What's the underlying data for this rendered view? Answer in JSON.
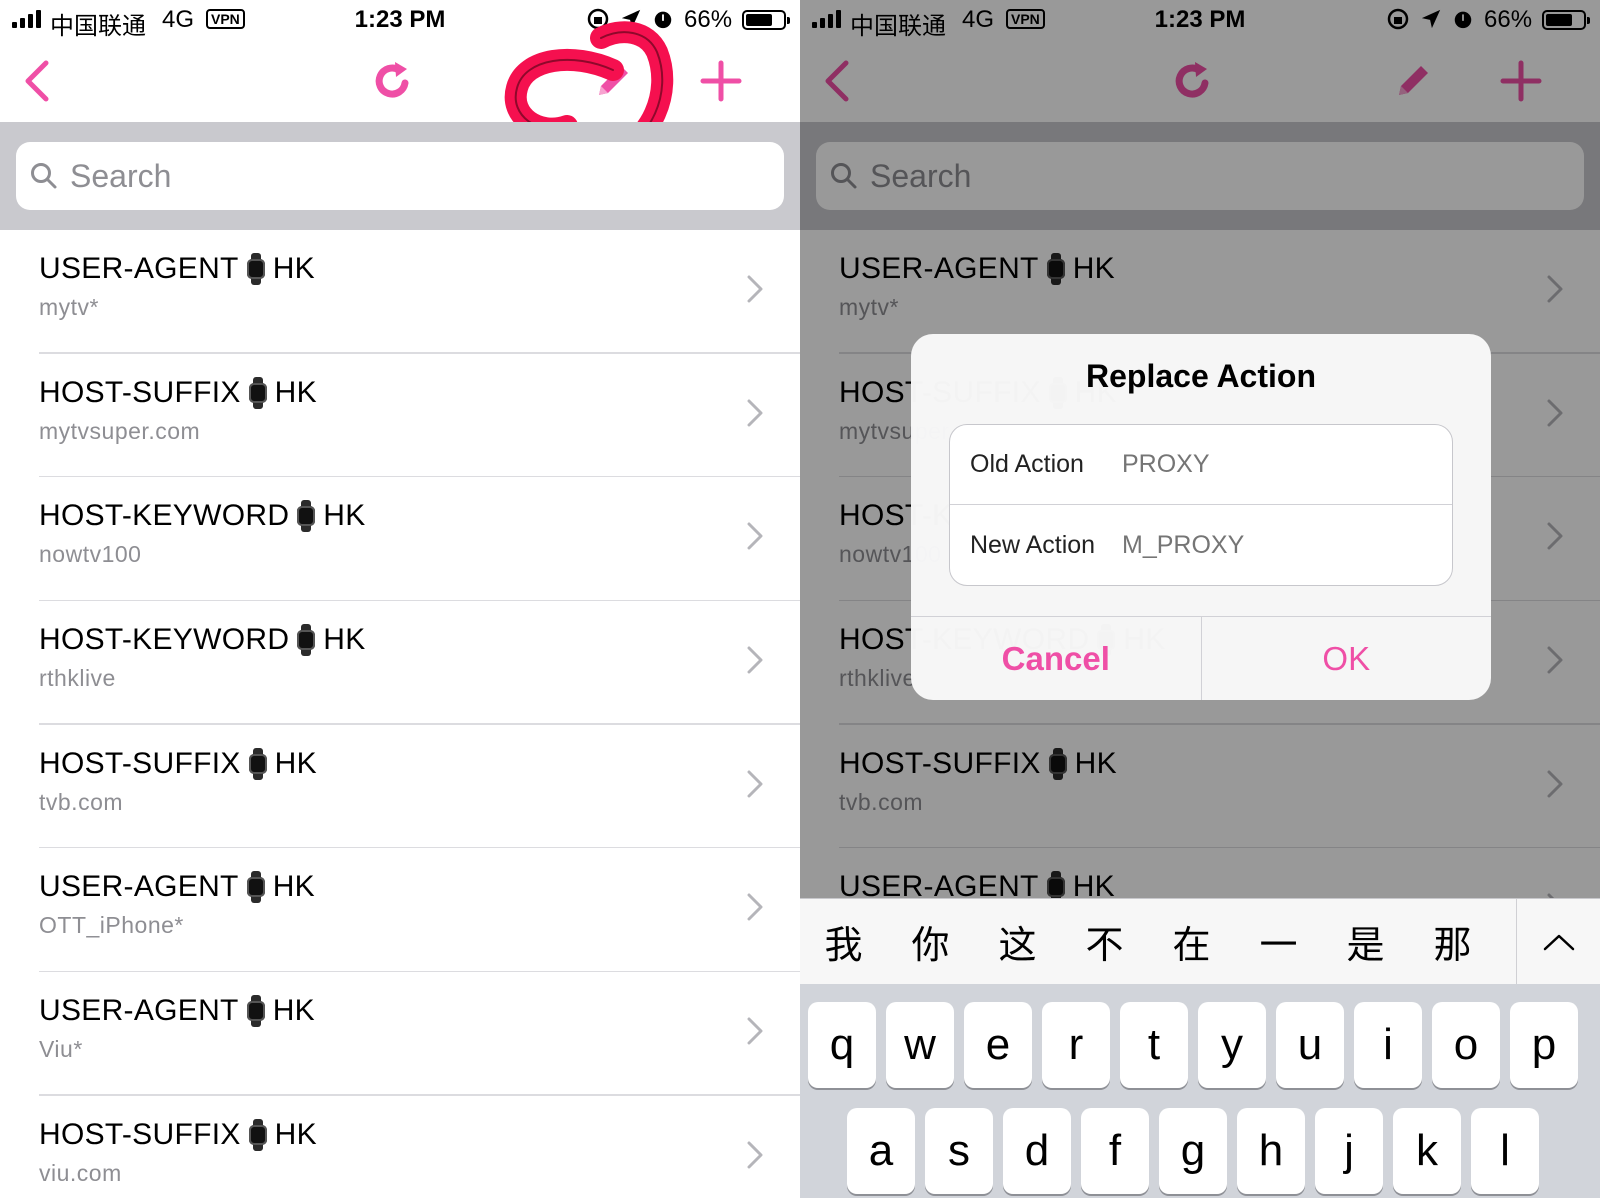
{
  "status_bar": {
    "carrier": "中国联通",
    "network": "4G",
    "vpn_badge": "VPN",
    "time": "1:23 PM",
    "battery_percent": "66%",
    "battery_level": 0.66
  },
  "search": {
    "placeholder": "Search"
  },
  "rules": [
    {
      "type": "USER-AGENT",
      "policy": "HK",
      "value": "mytv*"
    },
    {
      "type": "HOST-SUFFIX",
      "policy": "HK",
      "value": "mytvsuper.com"
    },
    {
      "type": "HOST-KEYWORD",
      "policy": "HK",
      "value": "nowtv100"
    },
    {
      "type": "HOST-KEYWORD",
      "policy": "HK",
      "value": "rthklive"
    },
    {
      "type": "HOST-SUFFIX",
      "policy": "HK",
      "value": "tvb.com"
    },
    {
      "type": "USER-AGENT",
      "policy": "HK",
      "value": "OTT_iPhone*"
    },
    {
      "type": "USER-AGENT",
      "policy": "HK",
      "value": "Viu*"
    },
    {
      "type": "HOST-SUFFIX",
      "policy": "HK",
      "value": "viu.com"
    }
  ],
  "right_list": {
    "rows": [
      {
        "type": "USER-AGENT",
        "policy": "HK",
        "value": "mytv*"
      },
      {
        "type": "HOST-SUFFIX",
        "policy": "HK",
        "value": "mytvsuper.com"
      },
      {
        "type": "HOST-KEYWORD",
        "policy": "HK",
        "value": "nowtv100"
      },
      {
        "type": "HOST-KEYWORD",
        "policy": "HK",
        "value": "rthklive"
      },
      {
        "type": "HOST-SUFFIX",
        "policy": "HK",
        "value": "tvb.com"
      },
      {
        "type": "USER-AGENT",
        "policy": "HK",
        "value": ""
      }
    ]
  },
  "dialog": {
    "title": "Replace Action",
    "old_label": "Old Action",
    "old_placeholder": "PROXY",
    "new_label": "New Action",
    "new_placeholder": "M_PROXY",
    "cancel": "Cancel",
    "ok": "OK"
  },
  "keyboard": {
    "candidates": [
      "我",
      "你",
      "这",
      "不",
      "在",
      "一",
      "是",
      "那"
    ],
    "row1": [
      "q",
      "w",
      "e",
      "r",
      "t",
      "y",
      "u",
      "i",
      "o",
      "p"
    ],
    "row2": [
      "a",
      "s",
      "d",
      "f",
      "g",
      "h",
      "j",
      "k",
      "l"
    ]
  },
  "colors": {
    "accent": "#ef4fa6",
    "annotation": "#f5104f",
    "search_band": "#c9c9ce",
    "secondary_text": "#8e8e93"
  },
  "icons": {
    "back": "chevron-left-icon",
    "refresh": "refresh-icon",
    "edit": "pencil-icon",
    "add": "plus-icon",
    "search": "magnifier-icon",
    "row_disclosure": "chevron-right-icon",
    "policy_emoji": "watch-icon"
  }
}
